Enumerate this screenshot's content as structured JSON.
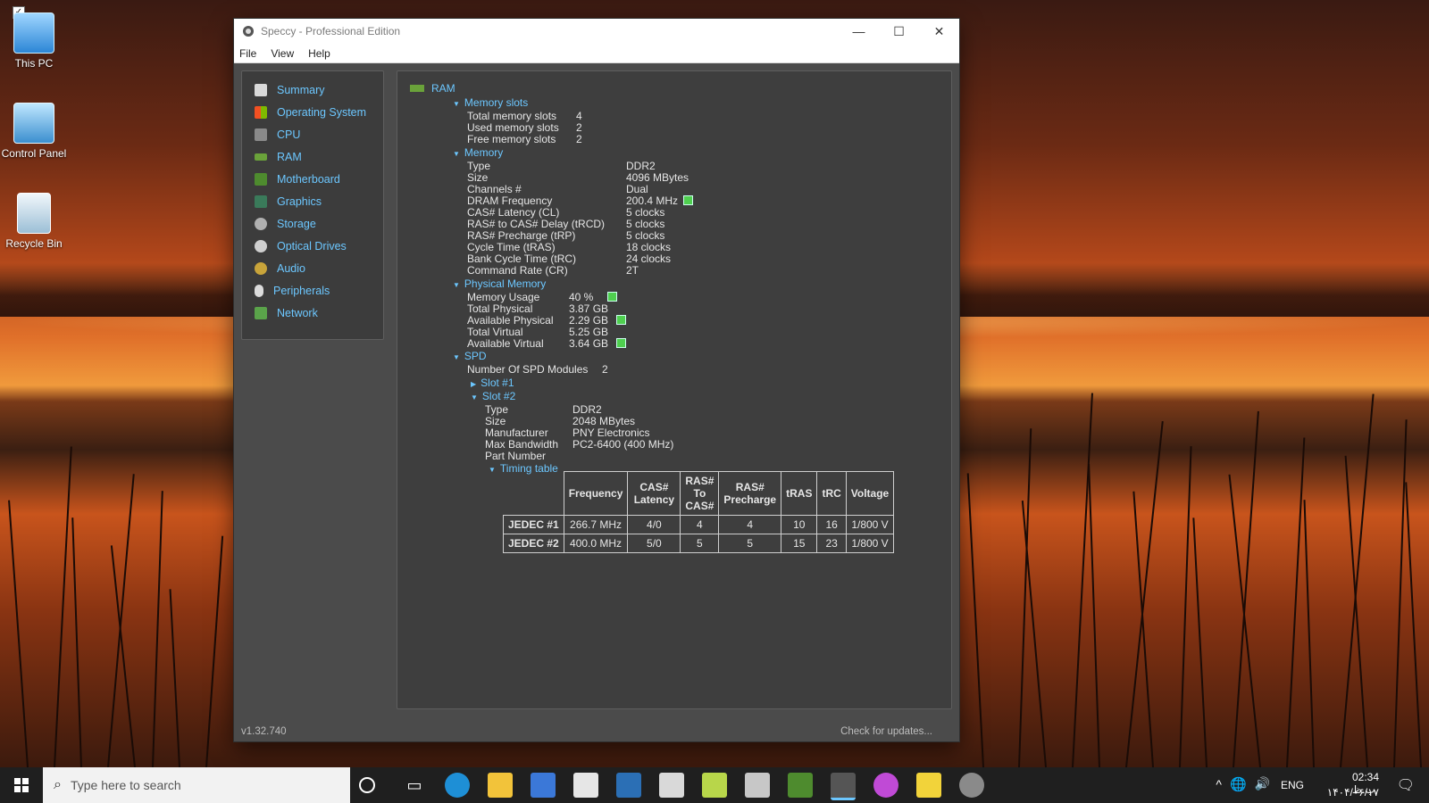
{
  "desktop": {
    "icons": [
      {
        "label": "This PC"
      },
      {
        "label": "Control Panel"
      },
      {
        "label": "Recycle Bin"
      }
    ]
  },
  "window": {
    "title": "Speccy - Professional Edition",
    "menu": [
      "File",
      "View",
      "Help"
    ],
    "sidebar": [
      "Summary",
      "Operating System",
      "CPU",
      "RAM",
      "Motherboard",
      "Graphics",
      "Storage",
      "Optical Drives",
      "Audio",
      "Peripherals",
      "Network"
    ],
    "status": {
      "version": "v1.32.740",
      "check_updates": "Check for updates..."
    }
  },
  "ram": {
    "heading": "RAM",
    "memory_slots": {
      "label": "Memory slots",
      "rows": [
        {
          "k": "Total memory slots",
          "v": "4"
        },
        {
          "k": "Used memory slots",
          "v": "2"
        },
        {
          "k": "Free memory slots",
          "v": "2"
        }
      ]
    },
    "memory": {
      "label": "Memory",
      "rows": [
        {
          "k": "Type",
          "v": "DDR2"
        },
        {
          "k": "Size",
          "v": "4096 MBytes"
        },
        {
          "k": "Channels #",
          "v": "Dual"
        },
        {
          "k": "DRAM Frequency",
          "v": "200.4 MHz"
        },
        {
          "k": "CAS# Latency (CL)",
          "v": "5 clocks"
        },
        {
          "k": "RAS# to CAS# Delay (tRCD)",
          "v": "5 clocks"
        },
        {
          "k": "RAS# Precharge (tRP)",
          "v": "5 clocks"
        },
        {
          "k": "Cycle Time (tRAS)",
          "v": "18 clocks"
        },
        {
          "k": "Bank Cycle Time (tRC)",
          "v": "24 clocks"
        },
        {
          "k": "Command Rate (CR)",
          "v": "2T"
        }
      ]
    },
    "physical_memory": {
      "label": "Physical Memory",
      "rows": [
        {
          "k": "Memory Usage",
          "v": "40 %"
        },
        {
          "k": "Total Physical",
          "v": "3.87 GB"
        },
        {
          "k": "Available Physical",
          "v": "2.29 GB"
        },
        {
          "k": "Total Virtual",
          "v": "5.25 GB"
        },
        {
          "k": "Available Virtual",
          "v": "3.64 GB"
        }
      ]
    },
    "spd": {
      "label": "SPD",
      "modules_label": "Number Of SPD Modules",
      "modules_value": "2",
      "slot1": "Slot #1",
      "slot2": "Slot #2",
      "slot2_rows": [
        {
          "k": "Type",
          "v": "DDR2"
        },
        {
          "k": "Size",
          "v": "2048 MBytes"
        },
        {
          "k": "Manufacturer",
          "v": "PNY Electronics"
        },
        {
          "k": "Max Bandwidth",
          "v": "PC2-6400 (400 MHz)"
        },
        {
          "k": "Part Number",
          "v": ""
        }
      ],
      "timing_label": "Timing table",
      "timing_headers": [
        "Frequency",
        "CAS# Latency",
        "RAS# To CAS#",
        "RAS# Precharge",
        "tRAS",
        "tRC",
        "Voltage"
      ],
      "timing_rows": [
        {
          "name": "JEDEC #1",
          "cells": [
            "266.7 MHz",
            "4/0",
            "4",
            "4",
            "10",
            "16",
            "1/800 V"
          ]
        },
        {
          "name": "JEDEC #2",
          "cells": [
            "400.0 MHz",
            "5/0",
            "5",
            "5",
            "15",
            "23",
            "1/800 V"
          ]
        }
      ]
    }
  },
  "taskbar": {
    "search_placeholder": "Type here to search",
    "lang": "ENG",
    "time": "02:34 ب.ظ",
    "date": "۱۴۰۴/۰۶/۱۷"
  }
}
